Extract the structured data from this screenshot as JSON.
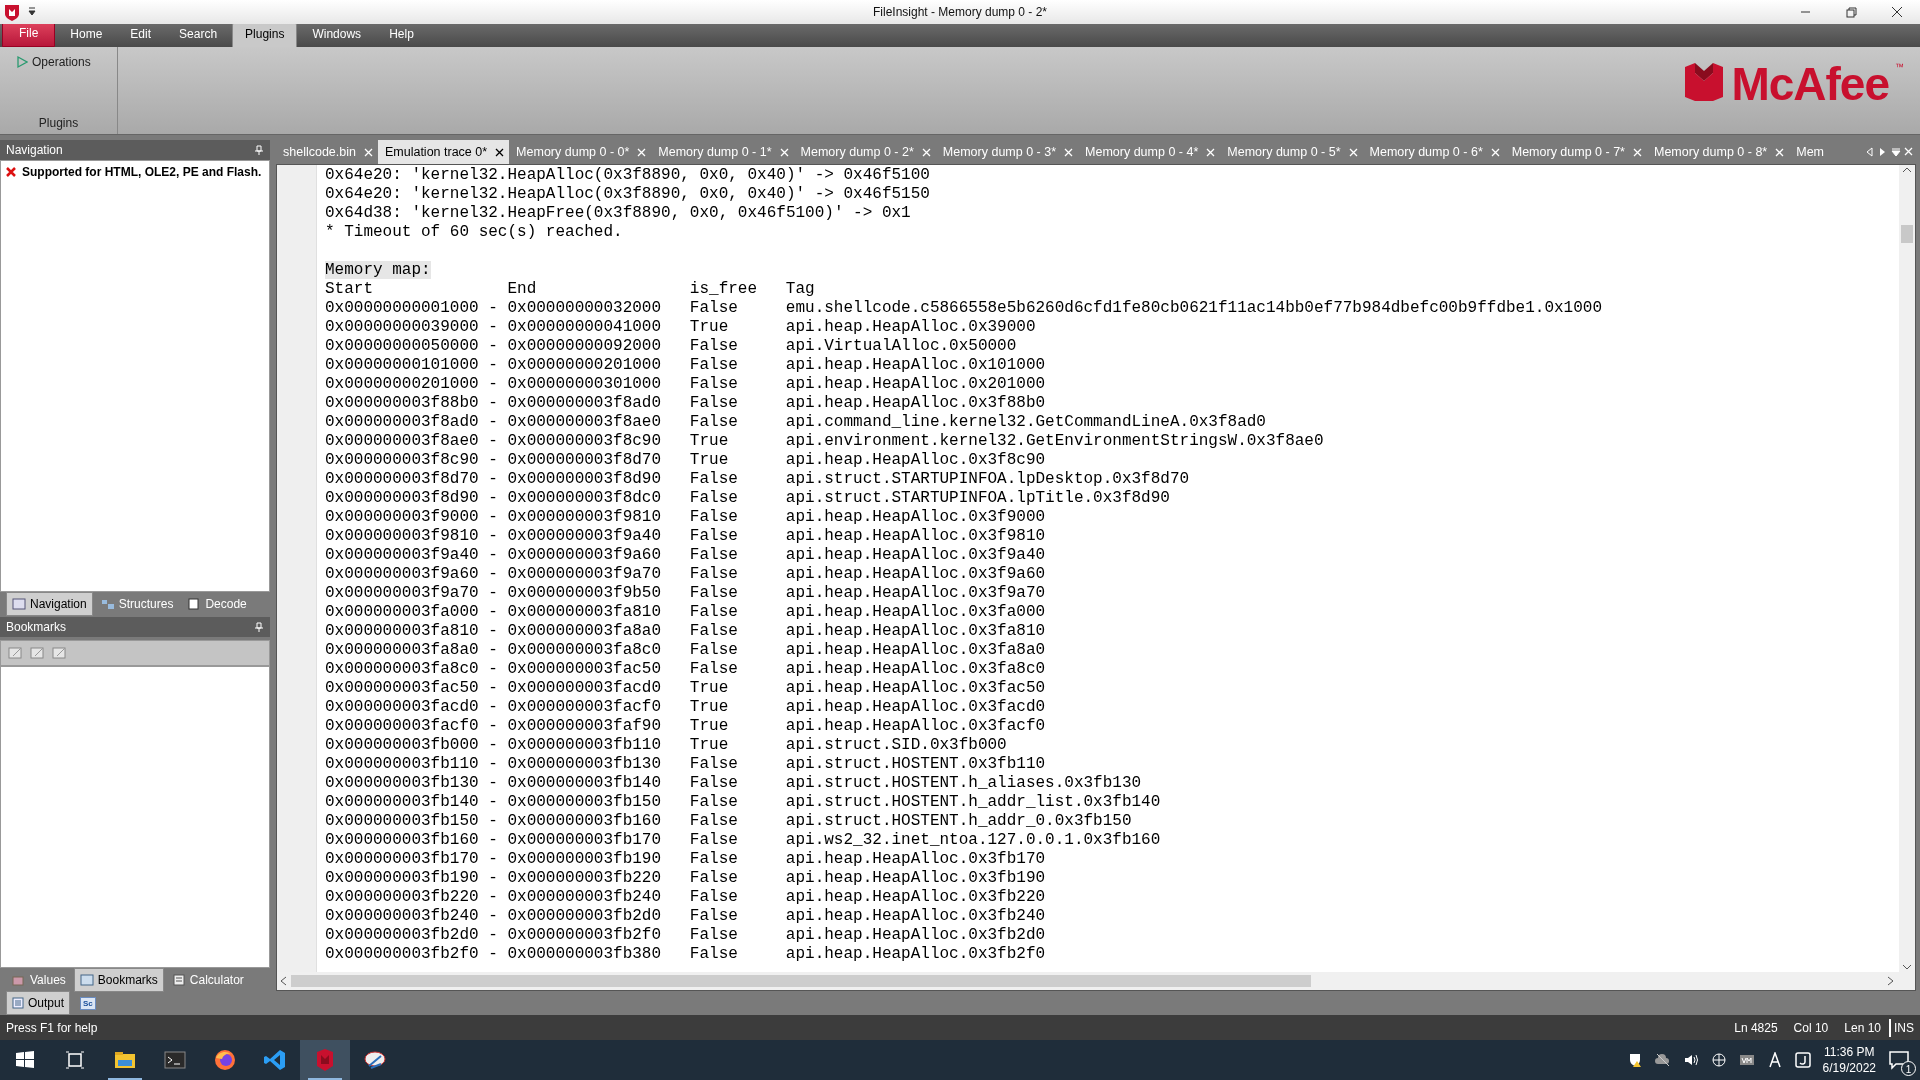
{
  "window": {
    "title": "FileInsight - Memory dump 0 - 2*"
  },
  "menu": [
    {
      "label": "File",
      "kind": "file",
      "selected": false
    },
    {
      "label": "Home",
      "kind": "tab",
      "selected": false
    },
    {
      "label": "Edit",
      "kind": "tab",
      "selected": false
    },
    {
      "label": "Search",
      "kind": "tab",
      "selected": false
    },
    {
      "label": "Plugins",
      "kind": "tab",
      "selected": true
    },
    {
      "label": "Windows",
      "kind": "tab",
      "selected": false
    },
    {
      "label": "Help",
      "kind": "tab",
      "selected": false
    }
  ],
  "ribbon": {
    "groups": [
      {
        "label": "Plugins",
        "items": [
          {
            "label": "Operations"
          }
        ]
      }
    ],
    "logo": {
      "text": "McAfee",
      "mark": "™"
    }
  },
  "navigation": {
    "title": "Navigation",
    "items": [
      {
        "text": "Supported for HTML, OLE2, PE and Flash."
      }
    ],
    "tabs": [
      {
        "label": "Navigation",
        "selected": true
      },
      {
        "label": "Structures",
        "selected": false
      },
      {
        "label": "Decode",
        "selected": false
      }
    ]
  },
  "bookmarks": {
    "title": "Bookmarks",
    "tabs": [
      {
        "label": "Values",
        "selected": false
      },
      {
        "label": "Bookmarks",
        "selected": true
      },
      {
        "label": "Calculator",
        "selected": false
      }
    ]
  },
  "output_tabs": [
    {
      "label": "Output",
      "kind": "output",
      "selected": true
    },
    {
      "label": "Sc",
      "kind": "script",
      "selected": false
    }
  ],
  "doc_tabs": [
    {
      "label": "shellcode.bin",
      "selected": false
    },
    {
      "label": "Emulation trace 0*",
      "selected": true
    },
    {
      "label": "Memory dump 0 - 0*",
      "selected": false
    },
    {
      "label": "Memory dump 0 - 1*",
      "selected": false
    },
    {
      "label": "Memory dump 0 - 2*",
      "selected": false
    },
    {
      "label": "Memory dump 0 - 3*",
      "selected": false
    },
    {
      "label": "Memory dump 0 - 4*",
      "selected": false
    },
    {
      "label": "Memory dump 0 - 5*",
      "selected": false
    },
    {
      "label": "Memory dump 0 - 6*",
      "selected": false
    },
    {
      "label": "Memory dump 0 - 7*",
      "selected": false
    },
    {
      "label": "Memory dump 0 - 8*",
      "selected": false
    },
    {
      "label": "Mem",
      "selected": false,
      "cut": true
    }
  ],
  "editor": {
    "lines": [
      "0x64e20: 'kernel32.HeapAlloc(0x3f8890, 0x0, 0x40)' -> 0x46f5100",
      "0x64e20: 'kernel32.HeapAlloc(0x3f8890, 0x0, 0x40)' -> 0x46f5150",
      "0x64d38: 'kernel32.HeapFree(0x3f8890, 0x0, 0x46f5100)' -> 0x1",
      "* Timeout of 60 sec(s) reached."
    ],
    "memory_map": {
      "title": "Memory map:",
      "separator": "-",
      "columns": [
        "Start",
        "End",
        "is_free",
        "Tag"
      ],
      "rows": [
        {
          "start": "0x00000000001000",
          "end": "0x00000000032000",
          "is_free": "False",
          "tag": "emu.shellcode.c5866558e5b6260d6cfd1fe80cb0621f11ac14bb0ef77b984dbefc00b9ffdbe1.0x1000"
        },
        {
          "start": "0x00000000039000",
          "end": "0x00000000041000",
          "is_free": "True",
          "tag": "api.heap.HeapAlloc.0x39000"
        },
        {
          "start": "0x00000000050000",
          "end": "0x00000000092000",
          "is_free": "False",
          "tag": "api.VirtualAlloc.0x50000"
        },
        {
          "start": "0x00000000101000",
          "end": "0x00000000201000",
          "is_free": "False",
          "tag": "api.heap.HeapAlloc.0x101000"
        },
        {
          "start": "0x00000000201000",
          "end": "0x00000000301000",
          "is_free": "False",
          "tag": "api.heap.HeapAlloc.0x201000"
        },
        {
          "start": "0x000000003f88b0",
          "end": "0x000000003f8ad0",
          "is_free": "False",
          "tag": "api.heap.HeapAlloc.0x3f88b0"
        },
        {
          "start": "0x000000003f8ad0",
          "end": "0x000000003f8ae0",
          "is_free": "False",
          "tag": "api.command_line.kernel32.GetCommandLineA.0x3f8ad0"
        },
        {
          "start": "0x000000003f8ae0",
          "end": "0x000000003f8c90",
          "is_free": "True",
          "tag": "api.environment.kernel32.GetEnvironmentStringsW.0x3f8ae0"
        },
        {
          "start": "0x000000003f8c90",
          "end": "0x000000003f8d70",
          "is_free": "True",
          "tag": "api.heap.HeapAlloc.0x3f8c90"
        },
        {
          "start": "0x000000003f8d70",
          "end": "0x000000003f8d90",
          "is_free": "False",
          "tag": "api.struct.STARTUPINFOA.lpDesktop.0x3f8d70"
        },
        {
          "start": "0x000000003f8d90",
          "end": "0x000000003f8dc0",
          "is_free": "False",
          "tag": "api.struct.STARTUPINFOA.lpTitle.0x3f8d90"
        },
        {
          "start": "0x000000003f9000",
          "end": "0x000000003f9810",
          "is_free": "False",
          "tag": "api.heap.HeapAlloc.0x3f9000"
        },
        {
          "start": "0x000000003f9810",
          "end": "0x000000003f9a40",
          "is_free": "False",
          "tag": "api.heap.HeapAlloc.0x3f9810"
        },
        {
          "start": "0x000000003f9a40",
          "end": "0x000000003f9a60",
          "is_free": "False",
          "tag": "api.heap.HeapAlloc.0x3f9a40"
        },
        {
          "start": "0x000000003f9a60",
          "end": "0x000000003f9a70",
          "is_free": "False",
          "tag": "api.heap.HeapAlloc.0x3f9a60"
        },
        {
          "start": "0x000000003f9a70",
          "end": "0x000000003f9b50",
          "is_free": "False",
          "tag": "api.heap.HeapAlloc.0x3f9a70"
        },
        {
          "start": "0x000000003fa000",
          "end": "0x000000003fa810",
          "is_free": "False",
          "tag": "api.heap.HeapAlloc.0x3fa000"
        },
        {
          "start": "0x000000003fa810",
          "end": "0x000000003fa8a0",
          "is_free": "False",
          "tag": "api.heap.HeapAlloc.0x3fa810"
        },
        {
          "start": "0x000000003fa8a0",
          "end": "0x000000003fa8c0",
          "is_free": "False",
          "tag": "api.heap.HeapAlloc.0x3fa8a0"
        },
        {
          "start": "0x000000003fa8c0",
          "end": "0x000000003fac50",
          "is_free": "False",
          "tag": "api.heap.HeapAlloc.0x3fa8c0"
        },
        {
          "start": "0x000000003fac50",
          "end": "0x000000003facd0",
          "is_free": "True",
          "tag": "api.heap.HeapAlloc.0x3fac50"
        },
        {
          "start": "0x000000003facd0",
          "end": "0x000000003facf0",
          "is_free": "True",
          "tag": "api.heap.HeapAlloc.0x3facd0"
        },
        {
          "start": "0x000000003facf0",
          "end": "0x000000003faf90",
          "is_free": "True",
          "tag": "api.heap.HeapAlloc.0x3facf0"
        },
        {
          "start": "0x000000003fb000",
          "end": "0x000000003fb110",
          "is_free": "True",
          "tag": "api.struct.SID.0x3fb000"
        },
        {
          "start": "0x000000003fb110",
          "end": "0x000000003fb130",
          "is_free": "False",
          "tag": "api.struct.HOSTENT.0x3fb110"
        },
        {
          "start": "0x000000003fb130",
          "end": "0x000000003fb140",
          "is_free": "False",
          "tag": "api.struct.HOSTENT.h_aliases.0x3fb130"
        },
        {
          "start": "0x000000003fb140",
          "end": "0x000000003fb150",
          "is_free": "False",
          "tag": "api.struct.HOSTENT.h_addr_list.0x3fb140"
        },
        {
          "start": "0x000000003fb150",
          "end": "0x000000003fb160",
          "is_free": "False",
          "tag": "api.struct.HOSTENT.h_addr_0.0x3fb150"
        },
        {
          "start": "0x000000003fb160",
          "end": "0x000000003fb170",
          "is_free": "False",
          "tag": "api.ws2_32.inet_ntoa.127.0.0.1.0x3fb160"
        },
        {
          "start": "0x000000003fb170",
          "end": "0x000000003fb190",
          "is_free": "False",
          "tag": "api.heap.HeapAlloc.0x3fb170"
        },
        {
          "start": "0x000000003fb190",
          "end": "0x000000003fb220",
          "is_free": "False",
          "tag": "api.heap.HeapAlloc.0x3fb190"
        },
        {
          "start": "0x000000003fb220",
          "end": "0x000000003fb240",
          "is_free": "False",
          "tag": "api.heap.HeapAlloc.0x3fb220"
        },
        {
          "start": "0x000000003fb240",
          "end": "0x000000003fb2d0",
          "is_free": "False",
          "tag": "api.heap.HeapAlloc.0x3fb240"
        },
        {
          "start": "0x000000003fb2d0",
          "end": "0x000000003fb2f0",
          "is_free": "False",
          "tag": "api.heap.HeapAlloc.0x3fb2d0"
        },
        {
          "start": "0x000000003fb2f0",
          "end": "0x000000003fb380",
          "is_free": "False",
          "tag": "api.heap.HeapAlloc.0x3fb2f0"
        }
      ]
    }
  },
  "status_bar": {
    "help": "Press F1 for help",
    "fields": [
      "Ln 4825",
      "Col 10",
      "Len 10",
      "INS"
    ]
  },
  "taskbar": {
    "apps": [
      {
        "kind": "explorer",
        "active": false,
        "running": true
      },
      {
        "kind": "terminal",
        "active": false,
        "running": false
      },
      {
        "kind": "firefox",
        "active": false,
        "running": false
      },
      {
        "kind": "vscode",
        "active": false,
        "running": false
      },
      {
        "kind": "mcafee",
        "active": true,
        "running": true
      },
      {
        "kind": "snip",
        "active": false,
        "running": false
      }
    ],
    "time": "11:36 PM",
    "date": "6/19/2022",
    "notifications": "1"
  }
}
